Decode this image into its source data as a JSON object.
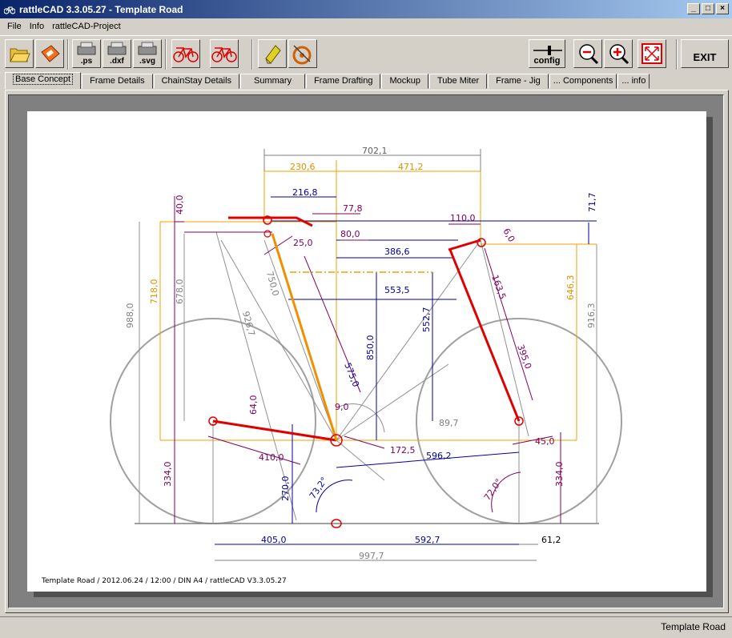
{
  "window": {
    "title": "rattleCAD  3.3.05.27 - Template Road",
    "min": "_",
    "max": "□",
    "close": "×"
  },
  "menu": [
    "File",
    "Info",
    "rattleCAD-Project"
  ],
  "toolbar": {
    "ps": ".ps",
    "dxf": ".dxf",
    "svg": ".svg",
    "config": "config",
    "exit": "EXIT"
  },
  "tabs": [
    "Base Concept",
    "Frame Details",
    "ChainStay Details",
    "Summary",
    "Frame Drafting",
    "Mockup",
    "Tube Miter",
    "Frame - Jig",
    "... Components",
    "... info"
  ],
  "footer_text": "Template Road   /   2012.06.24 / 12:00   /   DIN A4 /   rattleCAD   V3.3.05.27",
  "status": "Template Road",
  "dims": {
    "d702": "702,1",
    "d230": "230,6",
    "d471": "471,2",
    "d216": "216,8",
    "d77": "77,8",
    "d40": "40,0",
    "d717": "71,7",
    "d110": "110,0",
    "d25": "25,0",
    "d80": "80,0",
    "d3866": "386,6",
    "d5535": "553,5",
    "d988": "988,0",
    "d718": "718,0",
    "d678": "678,0",
    "d9267": "926,7",
    "d750": "750,0",
    "d575": "575,0",
    "d850": "850,0",
    "d5527": "552,7",
    "d1635": "163,5",
    "d3950": "395,0",
    "d6463": "646,3",
    "d9163": "916,3",
    "d640": "64,0",
    "d90": "9,0",
    "d897": "89,7",
    "d4100": "410,0",
    "d1725": "172,5",
    "d5962": "596,2",
    "d450": "45,0",
    "d334l": "334,0",
    "d334r": "334,0",
    "d2700": "270,0",
    "d732": "73,2°",
    "d720": "72,0°",
    "d4050": "405,0",
    "d5927": "592,7",
    "d612": "61,2",
    "d9977": "997,7",
    "d60": "6,0"
  }
}
